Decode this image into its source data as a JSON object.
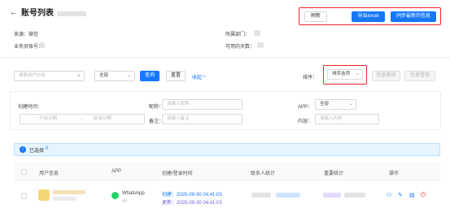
{
  "header": {
    "title": "账号列表",
    "back_icon": "arrow-left-icon"
  },
  "actions": {
    "refresh_label": "刷新",
    "export_label": "导出excel",
    "sync_label": "同步最新的信息"
  },
  "info": {
    "row1_left_label": "来源：",
    "row1_left_value": "微信",
    "row1_right_label": "所属部门：",
    "row2_left_label": "业务员账号：",
    "row2_right_label": "可用的天数："
  },
  "search": {
    "placeholder": "搜索用户ID名",
    "all_label": "全部",
    "query_label": "查询",
    "reset_label": "重置",
    "collapse_label": "收起"
  },
  "sort": {
    "label": "排序：",
    "select_label": "排序选项",
    "batch_delete_label": "批量删除",
    "batch_manage_label": "批量管理"
  },
  "filters": {
    "created_label": "创建时间：",
    "start_placeholder": "开始日期",
    "range_sep": "→",
    "end_placeholder": "结束日期",
    "nickname_label": "昵称：",
    "nickname_placeholder": "请输入昵称",
    "note_label": "备注：",
    "note_placeholder": "请输入备注",
    "app_label": "APP：",
    "app_value": "全部",
    "content_label": "内容：",
    "content_placeholder": "请输入内容"
  },
  "selection": {
    "text": "已选择",
    "count": "0"
  },
  "table": {
    "headers": [
      "用户信息",
      "APP",
      "创建/登录时间",
      "联系人统计",
      "重要统计",
      "操作"
    ],
    "rows": [
      {
        "app": "WhatsApp",
        "created": "创建：2025-09-30 04:41:03",
        "updated": "更新：2025-09-30 04:41:03"
      }
    ]
  },
  "colors": {
    "primary": "#1677ff",
    "danger": "#f5222d",
    "info_bg": "#e6f4ff",
    "whatsapp": "#25d366"
  }
}
